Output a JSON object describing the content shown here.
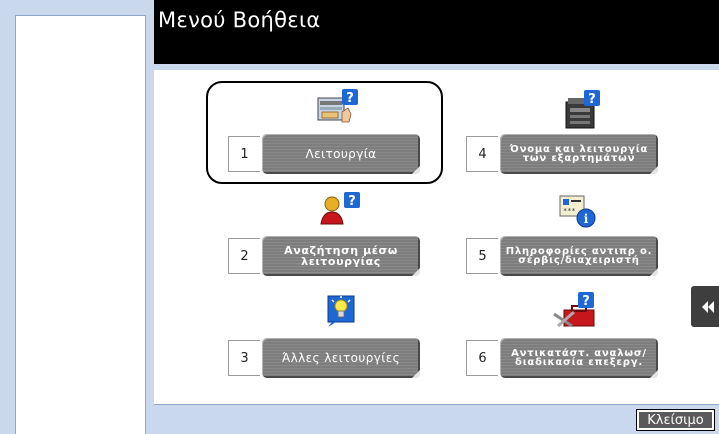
{
  "header": {
    "title": "Μενού Βοήθεια"
  },
  "menu": {
    "items": [
      {
        "num": "1",
        "label": "Λειτουργία",
        "icon": "function-help-icon",
        "selected": true
      },
      {
        "num": "2",
        "label": "Αναζήτηση μέσω λειτουργίας",
        "icon": "search-by-function-icon"
      },
      {
        "num": "3",
        "label": "Άλλες λειτουργίες",
        "icon": "other-functions-icon"
      },
      {
        "num": "4",
        "label": "Όνομα και λειτουργία των εξαρτημάτων",
        "icon": "parts-machine-icon"
      },
      {
        "num": "5",
        "label": "Πληροφορίες αντιπρ ο. σέρβις/διαχειριστή",
        "icon": "service-info-icon"
      },
      {
        "num": "6",
        "label": "Αντικατάστ. αναλωσ/ διαδικασία επεξεργ.",
        "icon": "consumables-toolbox-icon"
      }
    ]
  },
  "footer": {
    "close_label": "Κλείσιμο"
  },
  "side_tab": {
    "icon": "double-chevron-left-icon"
  },
  "colors": {
    "header_bg": "#000000",
    "frame_bg": "#c9d8ec",
    "button_bg": "#7d7d7d",
    "icon_blue": "#1e68d6"
  }
}
